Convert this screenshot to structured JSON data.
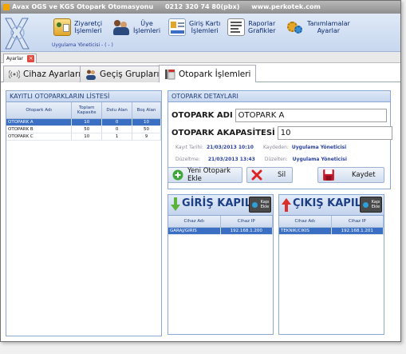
{
  "titlebar": {
    "app_title": "Avax OGS ve KGS Otopark Otomasyonu",
    "phone": "0212 320 74 80(pbx)",
    "website": "www.perkotek.com"
  },
  "toolbar": {
    "buttons": [
      {
        "label": "Ziyaretçi\nİşlemleri",
        "icon": "visitor-icon"
      },
      {
        "label": "Üye\nİşlemleri",
        "icon": "members-icon"
      },
      {
        "label": "Giriş Kartı\nİşlemleri",
        "icon": "card-icon"
      },
      {
        "label": "Raporlar\nGrafikler",
        "icon": "report-icon"
      },
      {
        "label": "Tanımlamalar\nAyarlar",
        "icon": "settings-icon"
      }
    ],
    "user_line": "Uygulama Yöneticisi - ( - )"
  },
  "doc_tab": {
    "label": "Ayarlar"
  },
  "main_tabs": [
    {
      "label": "Cihaz Ayarları",
      "active": false
    },
    {
      "label": "Geçiş Grupları",
      "active": false
    },
    {
      "label": "Otopark İşlemleri",
      "active": true
    }
  ],
  "parking_list": {
    "title": "KAYITLI OTOPARKLARIN LİSTESİ",
    "columns": [
      "Otopark Adı",
      "Toplam Kapasite",
      "Dolu Alan",
      "Boş Alan"
    ],
    "rows": [
      [
        "OTOPARK A",
        "10",
        "0",
        "10"
      ],
      [
        "OTOPARK B",
        "50",
        "0",
        "50"
      ],
      [
        "OTOPARK C",
        "10",
        "1",
        "9"
      ]
    ],
    "selected_row": 0
  },
  "details": {
    "title": "OTOPARK DETAYLARI",
    "name_label": "OTOPARK ADI",
    "name_value": "OTOPARK A",
    "capacity_label": "OTOPARK AKAPASİTESİ",
    "capacity_value": "10",
    "created_label": "Kayıt Tarihi:",
    "created_value": "21/03/2013 10:10",
    "created_by_label": "Kaydeden:",
    "created_by_value": "Uygulama Yöneticisi",
    "updated_label": "Düzeltme:",
    "updated_value": "21/03/2013 13:43",
    "updated_by_label": "Düzelten:",
    "updated_by_value": "Uygulama Yöneticisi"
  },
  "actions": {
    "new_label": "Yeni Otopark Ekle",
    "delete_label": "Sil",
    "save_label": "Kaydet"
  },
  "entry": {
    "title": "GİRİŞ KAPILA",
    "add_label": "Kapı Ekle",
    "columns": [
      "Cihaz Adı",
      "Cihaz IP"
    ],
    "rows": [
      [
        "GARAJ/GIRIS",
        "192.168.1.200"
      ]
    ]
  },
  "exit": {
    "title": "ÇIKIŞ KAPILA",
    "add_label": "Kapı Ekle",
    "columns": [
      "Cihaz Adı",
      "Cihaz IP"
    ],
    "rows": [
      [
        "TEKNIK/CIKIS",
        "192.168.1.201"
      ]
    ]
  },
  "colors": {
    "ribbon": "#c7d7ef",
    "selection": "#3a6fc4",
    "header_text": "#22407c",
    "link": "#2a3fa0"
  }
}
